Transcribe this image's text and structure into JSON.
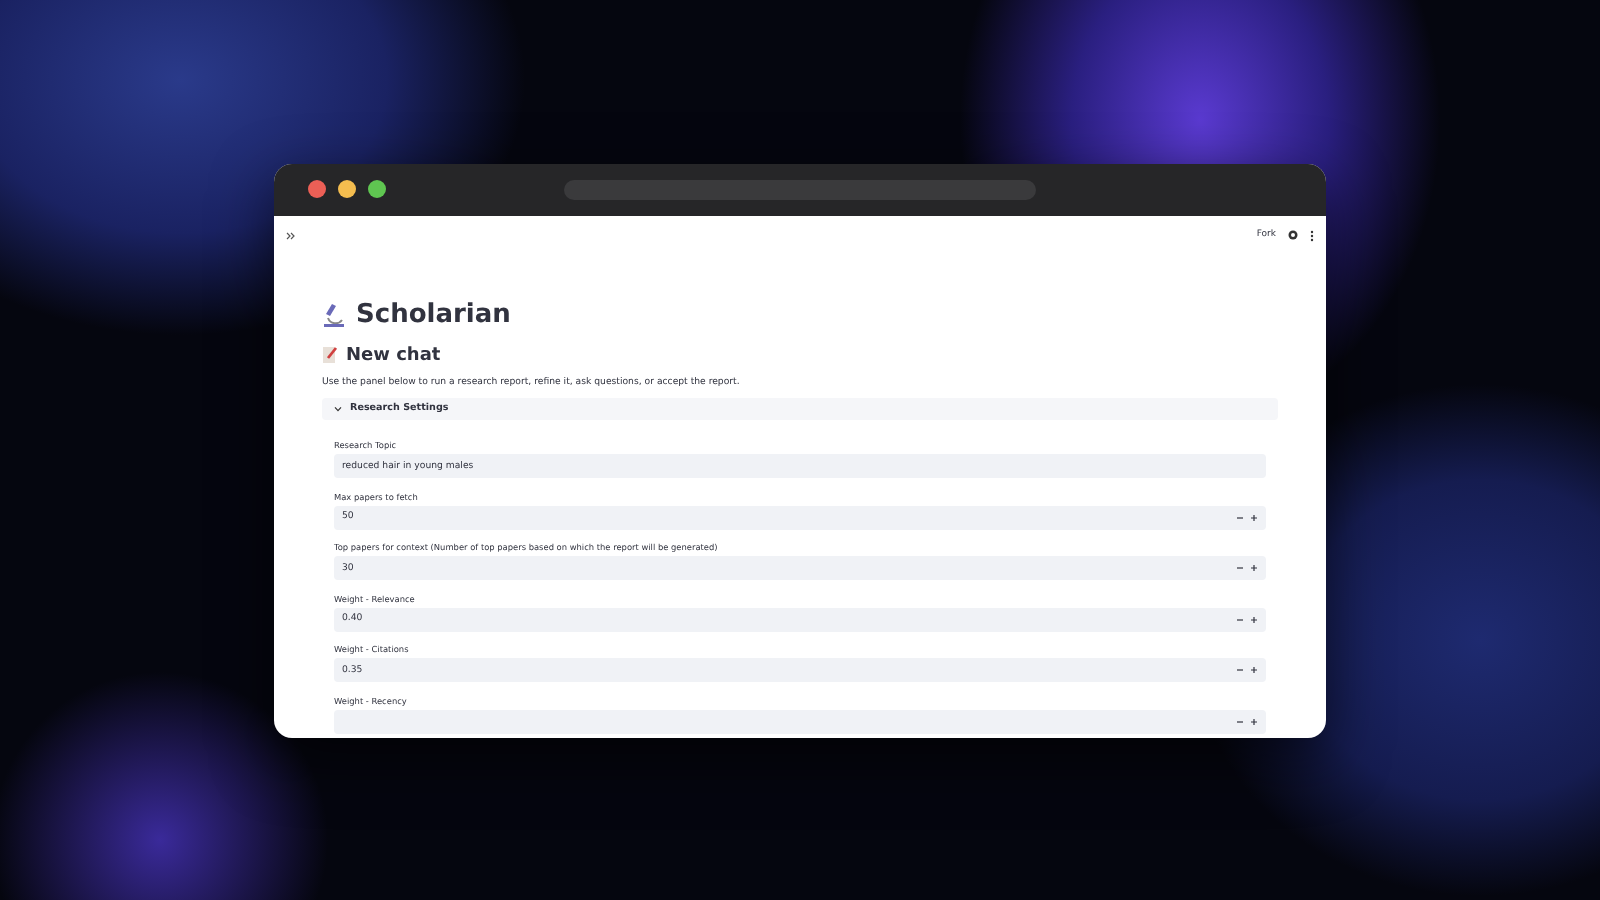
{
  "toolbar": {
    "fork_label": "Fork"
  },
  "title": "Scholarian",
  "subtitle": "New chat",
  "description": "Use the panel below to run a research report, refine it, ask questions, or accept the report.",
  "settings": {
    "title": "Research Settings",
    "expanded": true,
    "fields": [
      {
        "kind": "text",
        "label": "Research Topic",
        "value": "reduced hair in young males"
      },
      {
        "kind": "number",
        "label": "Max papers to fetch",
        "value": "50"
      },
      {
        "kind": "number",
        "label": "Top papers for context (Number of top papers based on which the report will be generated)",
        "value": "30"
      },
      {
        "kind": "number",
        "label": "Weight - Relevance",
        "value": "0.40"
      },
      {
        "kind": "number",
        "label": "Weight - Citations",
        "value": "0.35"
      },
      {
        "kind": "number",
        "label": "Weight - Recency"
      }
    ]
  }
}
